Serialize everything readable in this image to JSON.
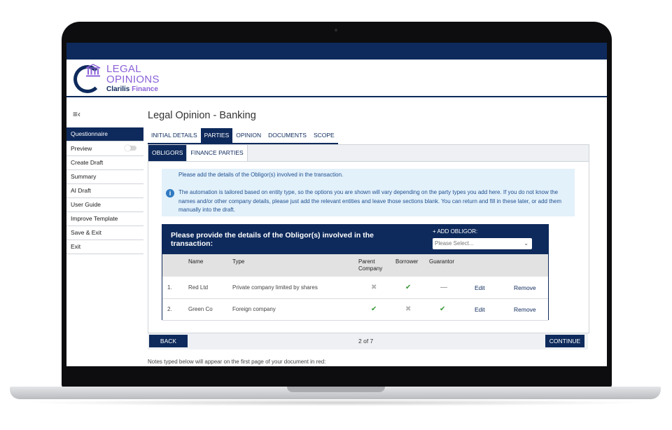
{
  "logo": {
    "line1": "LEGAL",
    "line2": "OPINIONS",
    "line3a": "Clarilis",
    "line3b": "Finance"
  },
  "sidebar": {
    "items": [
      "Questionnaire",
      "Preview",
      "Create Draft",
      "Summary",
      "AI Draft",
      "User Guide",
      "Improve Template",
      "Save & Exit",
      "Exit"
    ]
  },
  "page": {
    "title": "Legal Opinion - Banking"
  },
  "tabs": [
    "INITIAL DETAILS",
    "PARTIES",
    "OPINION",
    "DOCUMENTS",
    "SCOPE"
  ],
  "subtabs": [
    "OBLIGORS",
    "FINANCE PARTIES"
  ],
  "info": {
    "line1": "Please add the details of the Obligor(s) involved in the transaction.",
    "line2": "The automation is tailored based on entity type, so the options you are shown will vary depending on the party types you add here.  If you do not know the names and/or other company details, please just add the relevant entities and leave those sections blank.  You can return and fill in these later, or add them manually into the draft."
  },
  "obligors": {
    "title": "Please provide the details of the Obligor(s) involved in the transaction:",
    "add_label": "+ ADD OBLIGOR:",
    "select_placeholder": "Please Select...",
    "headers": {
      "name": "Name",
      "type": "Type",
      "parent": "Parent Company",
      "borrower": "Borrower",
      "guarantor": "Guarantor"
    },
    "rows": [
      {
        "num": "1.",
        "name": "Red Ltd",
        "type": "Private company limited by shares",
        "parent": "no",
        "borrower": "yes",
        "guarantor": "none",
        "edit": "Edit",
        "remove": "Remove"
      },
      {
        "num": "2.",
        "name": "Green Co",
        "type": "Foreign company",
        "parent": "yes",
        "borrower": "no",
        "guarantor": "yes",
        "edit": "Edit",
        "remove": "Remove"
      }
    ]
  },
  "footer": {
    "back": "BACK",
    "counter": "2 of 7",
    "continue": "CONTINUE"
  },
  "note": "Notes typed below will appear on the first page of your document in red:",
  "colors": {
    "navy": "#0e2a5c",
    "purple": "#8b62d8",
    "info_bg": "#e3f1fb",
    "check": "#3a9a3a"
  },
  "icons": {
    "menu": "menu-collapse-icon",
    "info": "info-icon",
    "yes": "check-icon",
    "no": "cross-icon",
    "none": "dash-icon"
  }
}
